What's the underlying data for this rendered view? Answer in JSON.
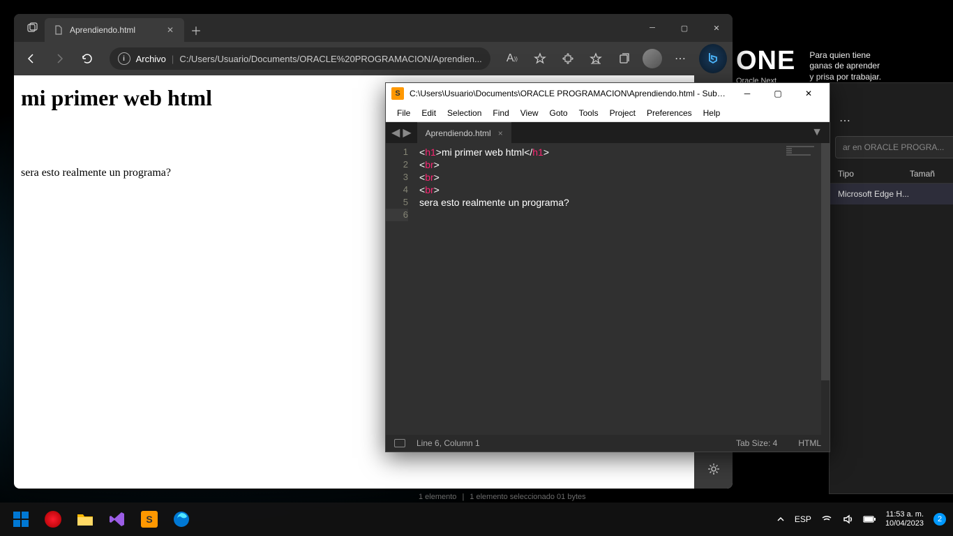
{
  "one_banner": {
    "logo": "ONE",
    "subtitle": "Oracle Next",
    "tagline_l1": "Para quien tiene",
    "tagline_l2": "ganas de aprender",
    "tagline_l3": "y prisa por trabajar."
  },
  "browser": {
    "tab_title": "Aprendiendo.html",
    "address_label": "Archivo",
    "address_path": "C:/Users/Usuario/Documents/ORACLE%20PROGRAMACION/Aprendien...",
    "page": {
      "heading": "mi primer web html",
      "paragraph": "sera esto realmente un programa?"
    }
  },
  "sublime": {
    "title": "C:\\Users\\Usuario\\Documents\\ORACLE PROGRAMACION\\Aprendiendo.html - Sublime ...",
    "menu": [
      "File",
      "Edit",
      "Selection",
      "Find",
      "View",
      "Goto",
      "Tools",
      "Project",
      "Preferences",
      "Help"
    ],
    "tab": "Aprendiendo.html",
    "lines": [
      {
        "n": "1",
        "parts": [
          {
            "t": "<",
            "c": "tag-bracket"
          },
          {
            "t": "h1",
            "c": "tag-name"
          },
          {
            "t": ">",
            "c": "tag-bracket"
          },
          {
            "t": "mi primer web html",
            "c": "text-content"
          },
          {
            "t": "</",
            "c": "tag-bracket"
          },
          {
            "t": "h1",
            "c": "tag-name"
          },
          {
            "t": ">",
            "c": "tag-bracket"
          }
        ]
      },
      {
        "n": "2",
        "parts": [
          {
            "t": "<",
            "c": "tag-bracket"
          },
          {
            "t": "br",
            "c": "tag-name"
          },
          {
            "t": ">",
            "c": "tag-bracket"
          }
        ]
      },
      {
        "n": "3",
        "parts": [
          {
            "t": "<",
            "c": "tag-bracket"
          },
          {
            "t": "br",
            "c": "tag-name"
          },
          {
            "t": ">",
            "c": "tag-bracket"
          }
        ]
      },
      {
        "n": "4",
        "parts": [
          {
            "t": "<",
            "c": "tag-bracket"
          },
          {
            "t": "br",
            "c": "tag-name"
          },
          {
            "t": ">",
            "c": "tag-bracket"
          }
        ]
      },
      {
        "n": "5",
        "parts": [
          {
            "t": "sera esto realmente un programa?",
            "c": "text-content"
          }
        ]
      },
      {
        "n": "6",
        "parts": []
      }
    ],
    "status_pos": "Line 6, Column 1",
    "status_tab": "Tab Size: 4",
    "status_lang": "HTML"
  },
  "explorer": {
    "search_placeholder": "ar en ORACLE PROGRA...",
    "col_type": "Tipo",
    "col_size": "Tamañ",
    "row_type": "Microsoft Edge H...",
    "more": "⋯"
  },
  "bottom_status": {
    "a": "1 elemento",
    "b": "1 elemento seleccionado  01 bytes"
  },
  "systray": {
    "lang": "ESP",
    "time": "11:53 a. m.",
    "date": "10/04/2023",
    "notif_count": "2"
  }
}
